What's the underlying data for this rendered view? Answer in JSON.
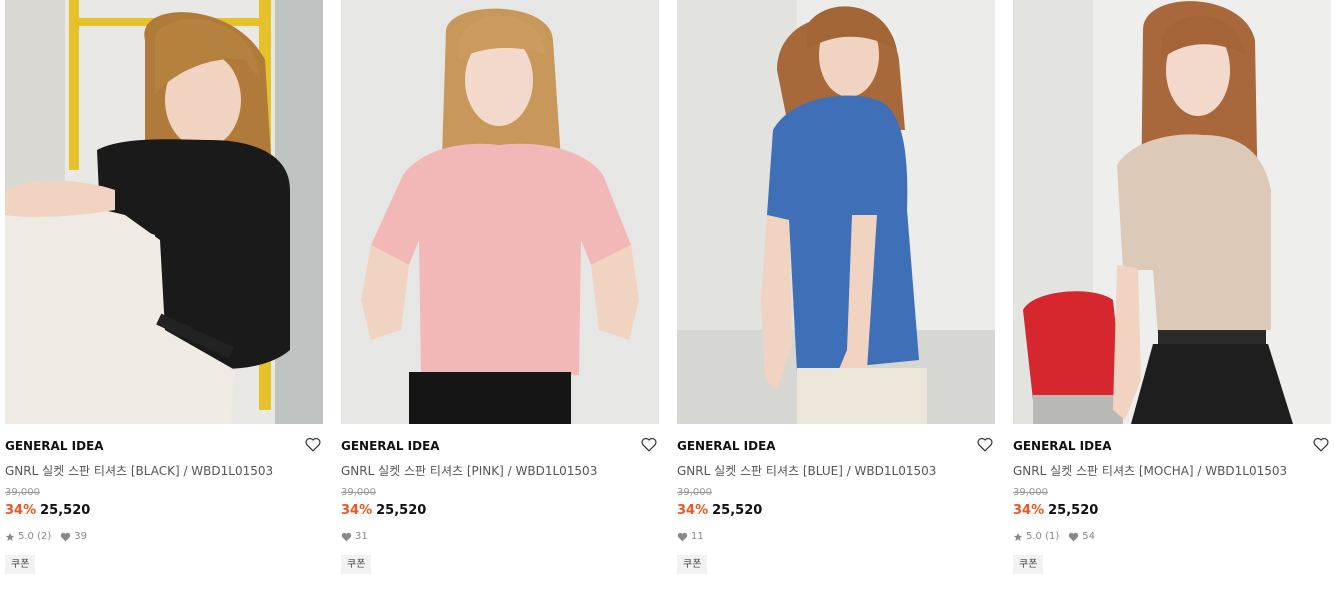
{
  "products": [
    {
      "brand": "GENERAL IDEA",
      "name": "GNRL 실켓 스판 티셔츠 [BLACK] / WBD1L01503",
      "original_price": "39,000",
      "discount": "34%",
      "sale_price": "25,520",
      "rating": "5.0",
      "reviews": "(2)",
      "likes": "39",
      "badge": "쿠폰",
      "shirt_color": "#1a1a1a",
      "bg_color": "#e9e8e4"
    },
    {
      "brand": "GENERAL IDEA",
      "name": "GNRL 실켓 스판 티셔츠 [PINK] / WBD1L01503",
      "original_price": "39,000",
      "discount": "34%",
      "sale_price": "25,520",
      "rating": "",
      "reviews": "",
      "likes": "31",
      "badge": "쿠폰",
      "shirt_color": "#f2b8b8",
      "bg_color": "#e6e6e4"
    },
    {
      "brand": "GENERAL IDEA",
      "name": "GNRL 실켓 스판 티셔츠 [BLUE] / WBD1L01503",
      "original_price": "39,000",
      "discount": "34%",
      "sale_price": "25,520",
      "rating": "",
      "reviews": "",
      "likes": "11",
      "badge": "쿠폰",
      "shirt_color": "#3f6fb6",
      "bg_color": "#ececea"
    },
    {
      "brand": "GENERAL IDEA",
      "name": "GNRL 실켓 스판 티셔츠 [MOCHA] / WBD1L01503",
      "original_price": "39,000",
      "discount": "34%",
      "sale_price": "25,520",
      "rating": "5.0",
      "reviews": "(1)",
      "likes": "54",
      "badge": "쿠폰",
      "shirt_color": "#dcc9b8",
      "bg_color": "#eeeeec"
    }
  ],
  "colors": {
    "discount": "#f1541c",
    "original_price": "#999999",
    "badge_bg": "#f2f2f2"
  },
  "icons": {
    "wishlist": "heart-outline-icon",
    "rating": "star-icon",
    "likes": "heart-filled-icon"
  }
}
